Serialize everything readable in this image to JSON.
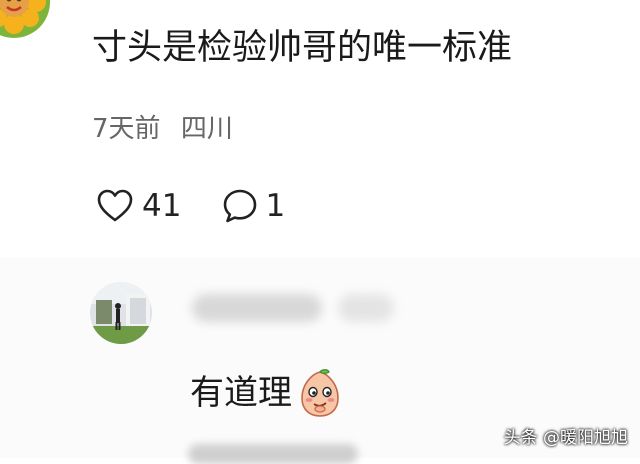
{
  "comment": {
    "text": "寸头是检验帅哥的唯一标准",
    "time": "7天前",
    "location": "四川",
    "like_count": "41",
    "reply_count": "1"
  },
  "reply": {
    "text": "有道理"
  },
  "watermark": "头条 @暖阳旭旭",
  "icons": {
    "like": "heart-outline-icon",
    "reply": "speech-bubble-icon",
    "emoji": "smirk-peach-emoji-icon"
  },
  "colors": {
    "text_primary": "#1a1a1a",
    "text_secondary": "#666666",
    "background": "#ffffff"
  }
}
